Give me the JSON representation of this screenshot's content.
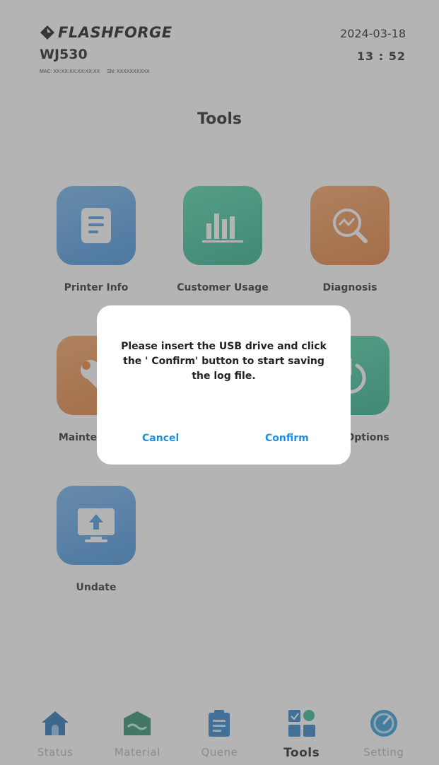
{
  "header": {
    "brand": "FLASHFORGE",
    "model": "WJ530",
    "mac": "MAC: XX:XX:XX:XX:XX:XX",
    "sn": "SN: XXXXXXXXXX",
    "date": "2024-03-18",
    "time": "13 : 52"
  },
  "page_title": "Tools",
  "tools": [
    {
      "label": "Printer Info",
      "icon": "document-icon",
      "color": "#4a98de"
    },
    {
      "label": "Customer Usage",
      "icon": "bar-chart-icon",
      "color": "#2fb892"
    },
    {
      "label": "Diagnosis",
      "icon": "magnifier-chart-icon",
      "color": "#e8843c"
    },
    {
      "label": "Mainte",
      "icon": "wrench-icon",
      "color": "#e8843c"
    },
    {
      "label": "Options",
      "icon": "power-icon",
      "color": "#2fb892"
    },
    {
      "label": "Undate",
      "icon": "upload-icon",
      "color": "#4a98de"
    }
  ],
  "dialog": {
    "message": "Please insert the USB drive and click the ' Confirm' button to start saving the log file.",
    "cancel_label": "Cancel",
    "confirm_label": "Confirm",
    "accent": "#1e8fe0"
  },
  "tabs": [
    {
      "label": "Status",
      "icon": "home-icon",
      "active": false
    },
    {
      "label": "Material",
      "icon": "material-icon",
      "active": false
    },
    {
      "label": "Quene",
      "icon": "clipboard-icon",
      "active": false
    },
    {
      "label": "Tools",
      "icon": "tools-grid-icon",
      "active": true
    },
    {
      "label": "Setting",
      "icon": "gauge-icon",
      "active": false
    }
  ]
}
